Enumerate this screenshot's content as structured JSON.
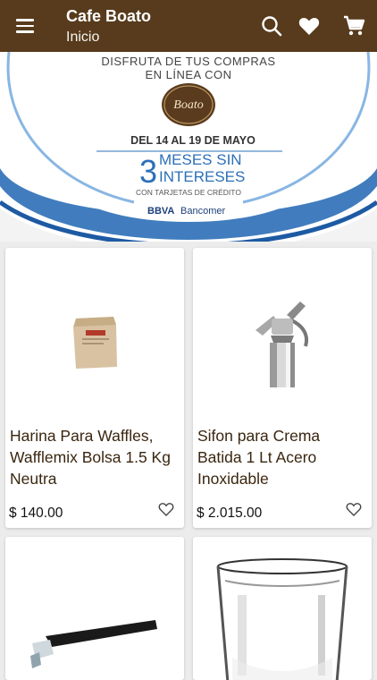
{
  "app": {
    "title": "Cafe Boato",
    "subtitle": "Inicio"
  },
  "icons": {
    "menu": "menu-icon",
    "search": "search-icon",
    "favorites": "heart-icon",
    "cart": "cart-icon"
  },
  "banner": {
    "line1": "DISFRUTA DE TUS COMPRAS",
    "line2": "EN LÍNEA CON",
    "logo_text": "Boato",
    "dates": "DEL 14 AL 19 DE MAYO",
    "msi_number": "3",
    "msi_line1": "MESES SIN",
    "msi_line2": "INTERESES",
    "cards_note": "CON TARJETAS DE CRÉDITO",
    "bank": "BBVA",
    "bank2": "Bancomer"
  },
  "products": [
    {
      "name": "Harina Para Waffles, Wafflemix Bolsa 1.5 Kg Neutra",
      "price": "$ 140.00"
    },
    {
      "name": "Sifon para Crema Batida 1 Lt Acero Inoxidable",
      "price": "$ 2.015.00"
    },
    {
      "name": "",
      "price": ""
    },
    {
      "name": "",
      "price": ""
    }
  ],
  "colors": {
    "appbar": "#573b1c",
    "accent_blue": "#2c6fb7",
    "product_text": "#3a2610"
  }
}
